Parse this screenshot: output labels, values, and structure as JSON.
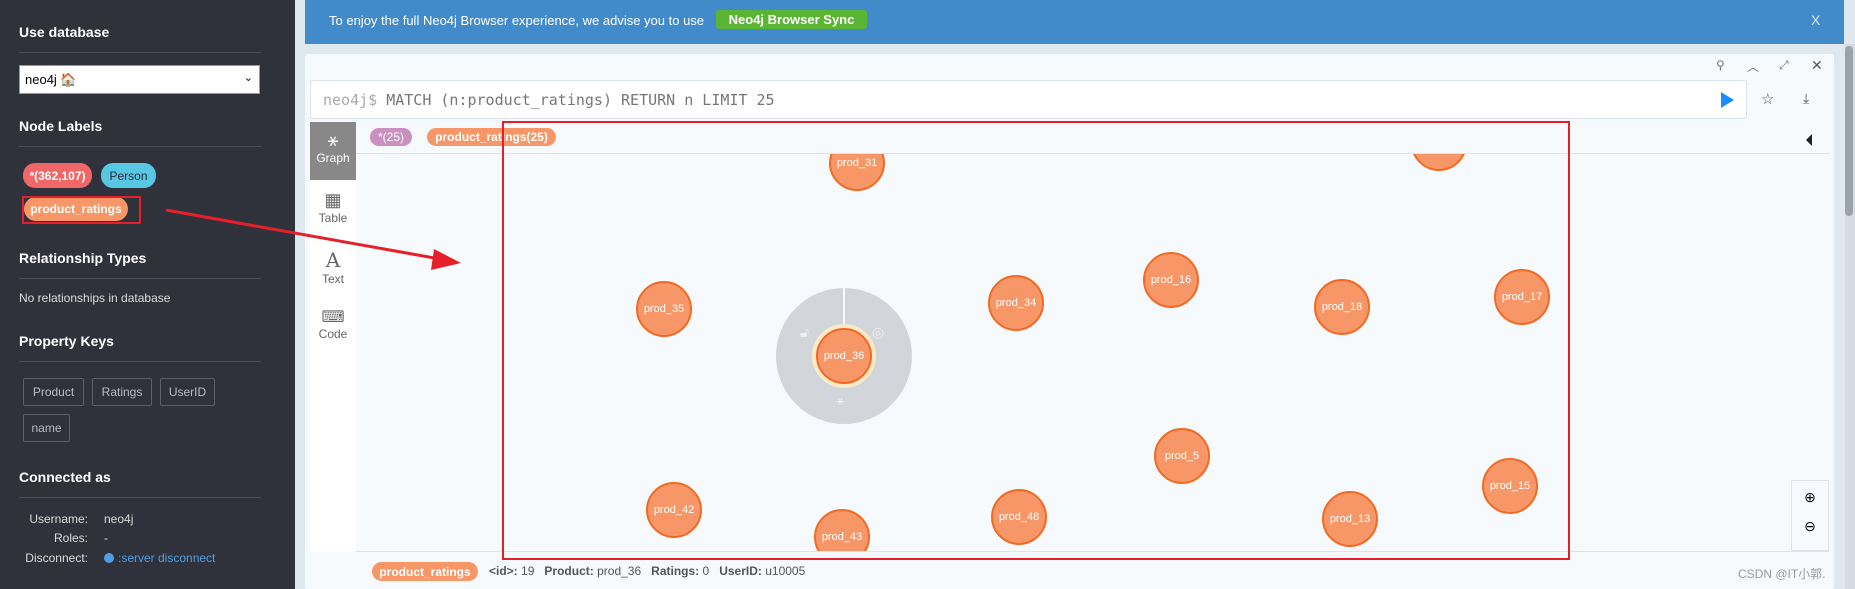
{
  "sidebar": {
    "use_database": "Use database",
    "database_value": "neo4j 🏠",
    "node_labels_title": "Node Labels",
    "node_labels": [
      {
        "label": "*(362,107)",
        "color": "#f16667"
      },
      {
        "label": "Person",
        "color": "#57c7e3"
      },
      {
        "label": "product_ratings",
        "color": "#f79767"
      }
    ],
    "relationship_types_title": "Relationship Types",
    "no_relationships": "No relationships in database",
    "property_keys_title": "Property Keys",
    "property_keys": [
      "Product",
      "Ratings",
      "UserID",
      "name"
    ],
    "connected_as_title": "Connected as",
    "username_label": "Username:",
    "username": "neo4j",
    "roles_label": "Roles:",
    "roles": "-",
    "disconnect_label": "Disconnect:",
    "disconnect_link": ":server disconnect"
  },
  "banner": {
    "text": "To enjoy the full Neo4j Browser experience, we advise you to use",
    "button": "Neo4j Browser Sync",
    "close": "X"
  },
  "editor": {
    "prompt": "neo4j$",
    "query": "MATCH (n:product_ratings) RETURN n LIMIT 25"
  },
  "view_tabs": [
    {
      "label": "Graph",
      "active": true
    },
    {
      "label": "Table"
    },
    {
      "label": "Text"
    },
    {
      "label": "Code"
    }
  ],
  "result_labels": [
    {
      "label": "*(25)",
      "color": "#c990c0"
    },
    {
      "label": "product_ratings(25)",
      "color": "#f79767"
    }
  ],
  "graph": {
    "nodes": [
      "prod_31",
      "prod_35",
      "prod_36",
      "prod_34",
      "prod_16",
      "prod_18",
      "prod_17",
      "prod_5",
      "prod_15",
      "prod_13",
      "prod_42",
      "prod_43",
      "prod_48"
    ],
    "selected": "prod_36",
    "node_color": "#f79767",
    "node_border": "#f36924"
  },
  "status": {
    "label": "product_ratings",
    "id_key": "<id>:",
    "id": "19",
    "product_key": "Product:",
    "product": "prod_36",
    "ratings_key": "Ratings:",
    "ratings": "0",
    "userid_key": "UserID:",
    "userid": "u10005"
  },
  "watermark": "CSDN @IT小郭."
}
